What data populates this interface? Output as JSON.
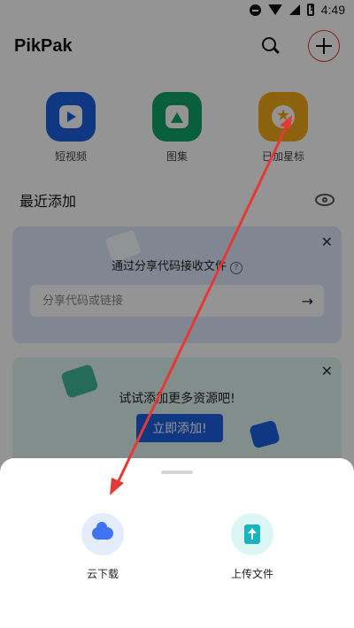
{
  "status_bar": {
    "time": "4:49"
  },
  "header": {
    "app_title": "PikPak"
  },
  "categories": [
    {
      "label": "短视频",
      "icon": "play-icon",
      "color": "#1d5fe0"
    },
    {
      "label": "图集",
      "icon": "image-icon",
      "color": "#10a466"
    },
    {
      "label": "已加星标",
      "icon": "star-icon",
      "color": "#f3a91b"
    }
  ],
  "recent": {
    "title": "最近添加"
  },
  "share_card": {
    "title": "通过分享代码接收文件",
    "help": "?",
    "close": "✕",
    "placeholder": "分享代码或链接",
    "submit_icon": "→"
  },
  "promo_card": {
    "title": "试试添加更多资源吧!",
    "button": "立即添加!",
    "close": "✕"
  },
  "sheet": {
    "actions": [
      {
        "label": "云下载",
        "icon": "cloud-link-icon"
      },
      {
        "label": "上传文件",
        "icon": "upload-icon"
      }
    ]
  },
  "colors": {
    "accent": "#1d5fe0",
    "annotation": "#e53935"
  }
}
